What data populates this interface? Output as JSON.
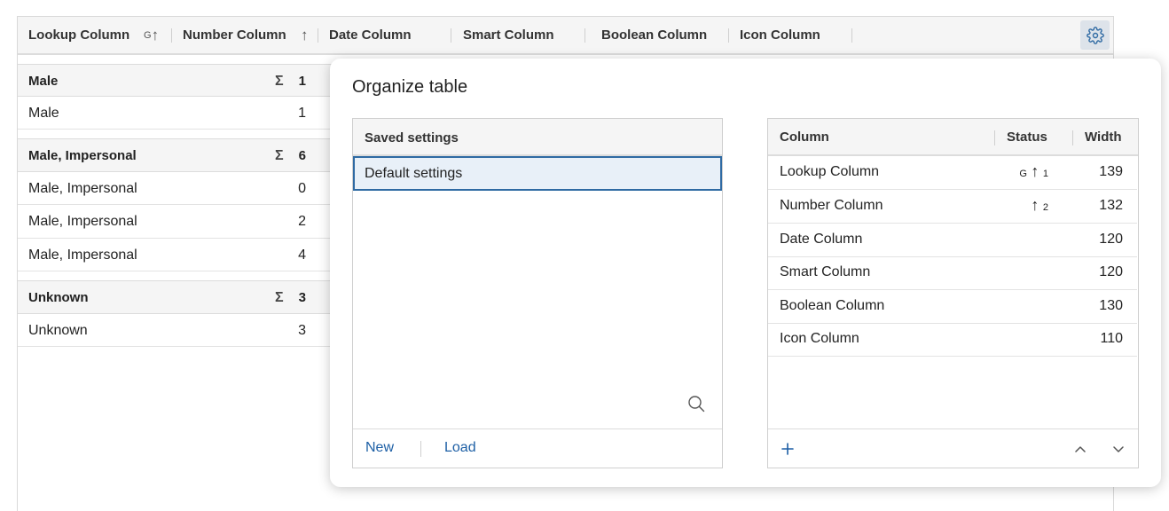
{
  "table": {
    "headers": [
      {
        "label": "Lookup Column",
        "indicator_group": "G",
        "indicator_arrow": "↑"
      },
      {
        "label": "Number Column",
        "indicator_arrow": "↑"
      },
      {
        "label": "Date Column"
      },
      {
        "label": "Smart Column"
      },
      {
        "label": "Boolean Column"
      },
      {
        "label": "Icon Column"
      }
    ],
    "sum_symbol": "Σ",
    "groups": [
      {
        "label": "Male",
        "sum": "1",
        "rows": [
          {
            "lookup": "Male",
            "number": "1"
          }
        ]
      },
      {
        "label": "Male, Impersonal",
        "sum": "6",
        "rows": [
          {
            "lookup": "Male, Impersonal",
            "number": "0"
          },
          {
            "lookup": "Male, Impersonal",
            "number": "2"
          },
          {
            "lookup": "Male, Impersonal",
            "number": "4"
          }
        ]
      },
      {
        "label": "Unknown",
        "sum": "3",
        "rows": [
          {
            "lookup": "Unknown",
            "number": "3"
          }
        ]
      }
    ],
    "settings_icon": "gear-icon"
  },
  "dialog": {
    "title": "Organize table",
    "saved_settings": {
      "header": "Saved settings",
      "items": [
        "Default settings"
      ],
      "search_icon": "search-icon",
      "new_label": "New",
      "load_label": "Load"
    },
    "columns_panel": {
      "headers": {
        "column": "Column",
        "status": "Status",
        "width": "Width"
      },
      "rows": [
        {
          "name": "Lookup Column",
          "status_group": "G",
          "status_arrow": "↑",
          "status_order": "1",
          "width": "139"
        },
        {
          "name": "Number Column",
          "status_arrow": "↑",
          "status_order": "2",
          "width": "132"
        },
        {
          "name": "Date Column",
          "width": "120"
        },
        {
          "name": "Smart Column",
          "width": "120"
        },
        {
          "name": "Boolean Column",
          "width": "130"
        },
        {
          "name": "Icon Column",
          "width": "110"
        }
      ],
      "add_icon": "plus-icon",
      "move_up_icon": "chevron-up-icon",
      "move_down_icon": "chevron-down-icon"
    }
  },
  "colors": {
    "accent": "#1d5fa5",
    "selected_bg": "#e8f0f8",
    "selected_border": "#2f6aa3",
    "header_bg": "#f5f5f5"
  }
}
